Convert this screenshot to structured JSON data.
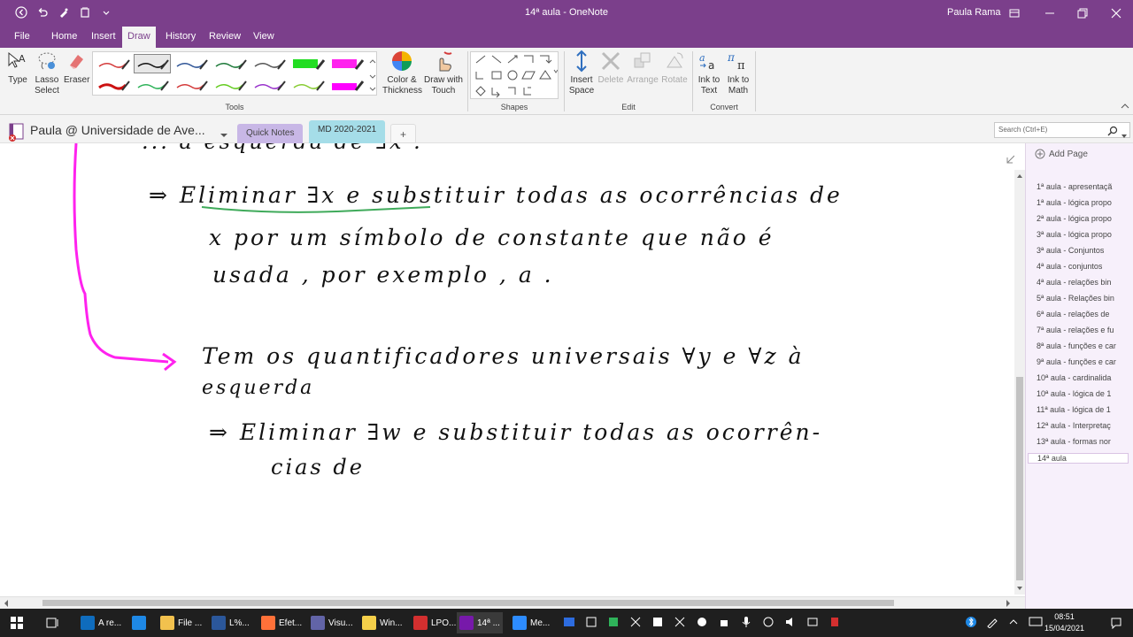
{
  "window": {
    "title": "14ª aula - OneNote",
    "user": "Paula Rama"
  },
  "menu_tabs": [
    "File",
    "Home",
    "Insert",
    "Draw",
    "History",
    "Review",
    "View"
  ],
  "active_tab": "Draw",
  "ribbon": {
    "tools": {
      "type_label": "Type",
      "lasso_label": "Lasso Select",
      "eraser_label": "Eraser",
      "group_label": "Tools",
      "pens": [
        {
          "color": "#d43a3a",
          "selected": false
        },
        {
          "color": "#111111",
          "selected": true
        },
        {
          "color": "#2f5597",
          "selected": false
        },
        {
          "color": "#1e7a3a",
          "selected": false
        },
        {
          "color": "#555555",
          "selected": false
        },
        {
          "color": "#22dd22",
          "selected": false
        },
        {
          "color": "#ff22ee",
          "selected": false
        },
        {
          "color": "#cc1111",
          "selected": false
        },
        {
          "color": "#2fb35a",
          "selected": false
        },
        {
          "color": "#d43a3a",
          "selected": false
        },
        {
          "color": "#66cc22",
          "selected": false
        },
        {
          "color": "#9933cc",
          "selected": false
        },
        {
          "color": "#88cc33",
          "selected": false
        },
        {
          "color": "#ff00ff",
          "selected": false
        }
      ],
      "color_thickness_label": "Color & Thickness",
      "draw_with_touch_label": "Draw with Touch"
    },
    "shapes": {
      "group_label": "Shapes"
    },
    "edit": {
      "insert_space_label": "Insert Space",
      "delete_label": "Delete",
      "arrange_label": "Arrange",
      "rotate_label": "Rotate",
      "group_label": "Edit"
    },
    "convert": {
      "ink_to_text_label": "Ink to Text",
      "ink_to_math_label": "Ink to Math",
      "group_label": "Convert"
    }
  },
  "notebook": {
    "name": "Paula @ Universidade de Ave...",
    "sections": [
      "Quick Notes",
      "MD 2020-2021"
    ],
    "active_section": "MD 2020-2021",
    "add_section": "+",
    "search_placeholder": "Search (Ctrl+E)"
  },
  "page_content": {
    "ink_lines": [
      "... à esquerda de ∃x .",
      "⇒ Eliminar ∃x e substituir todas as ocorrências de",
      "x por um símbolo de constante que não é",
      "usada , por exemplo , a .",
      "Tem os quantificadores universais ∀y e ∀z à",
      "esquerda",
      "⇒ Eliminar ∃w e substituir todas as ocorrên-",
      "cias de"
    ]
  },
  "pages_panel": {
    "add_page_label": "Add Page",
    "pages": [
      "1ª aula - apresentaçã",
      "1ª aula - lógica propo",
      "2ª aula - lógica propo",
      "3ª aula - lógica propo",
      "3ª aula - Conjuntos",
      "4ª aula - conjuntos",
      "4ª aula - relações bin",
      "5ª aula - Relações bin",
      "6ª aula - relações de",
      "7ª aula - relações e fu",
      "8ª aula - funções e car",
      "9ª aula - funções e car",
      "10ª aula - cardinalida",
      "10ª aula - lógica de 1",
      "11ª aula - lógica de 1",
      "12ª aula - Interpretaç",
      "13ª aula - formas nor",
      "14ª aula"
    ],
    "active_page": "14ª aula"
  },
  "taskbar": {
    "apps": [
      {
        "label": "A re...",
        "color": "#0f6cbd"
      },
      {
        "label": "",
        "color": "#1e88e5"
      },
      {
        "label": "File ...",
        "color": "#f2c14e"
      },
      {
        "label": "L%...",
        "color": "#2b579a"
      },
      {
        "label": "Efet...",
        "color": "#ff7139"
      },
      {
        "label": "Visu...",
        "color": "#6264a7"
      },
      {
        "label": "Win...",
        "color": "#f5d04a"
      },
      {
        "label": "LPO...",
        "color": "#d32f2f"
      },
      {
        "label": "14ª ...",
        "color": "#7719aa"
      },
      {
        "label": "Me...",
        "color": "#2d8cff"
      }
    ],
    "time": "08:51",
    "date": "15/04/2021"
  }
}
